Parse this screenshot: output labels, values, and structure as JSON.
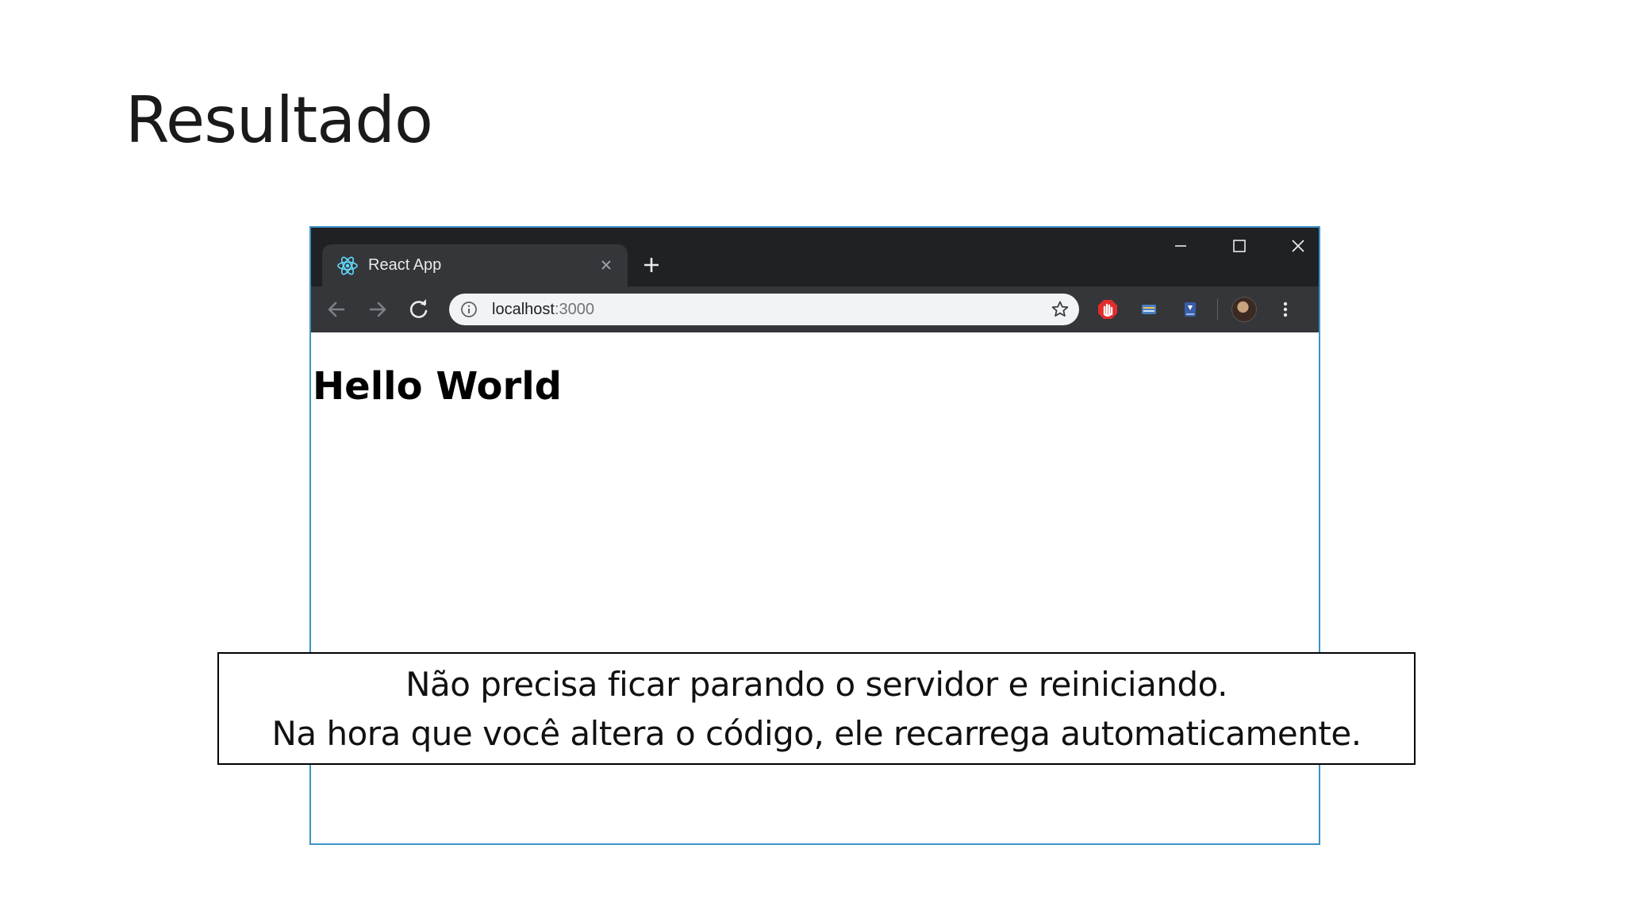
{
  "slide": {
    "title": "Resultado"
  },
  "browser": {
    "tab": {
      "title": "React App",
      "favicon": "react-atom-icon"
    },
    "address_bar": {
      "host": "localhost",
      "port": ":3000"
    },
    "colors": {
      "titlebar": "#202124",
      "toolbar": "#35363a",
      "omnibox": "#f1f3f4",
      "window_border": "#3c93c6"
    }
  },
  "page": {
    "heading": "Hello World"
  },
  "callout": {
    "line1": "Não precisa ficar parando o servidor e reiniciando.",
    "line2": "Na hora que você altera o código, ele recarrega automaticamente."
  }
}
